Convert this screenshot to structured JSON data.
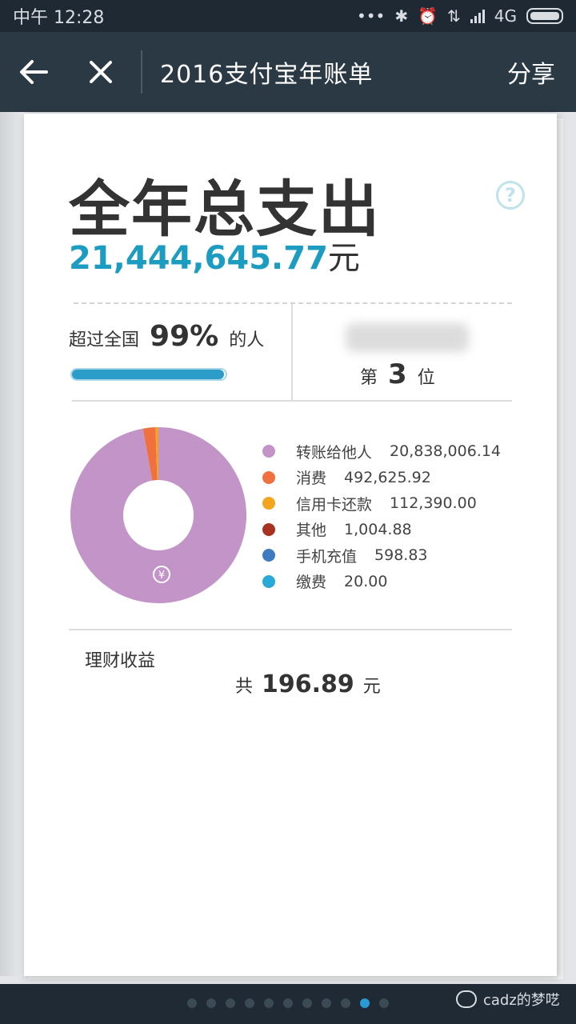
{
  "status_bar": {
    "time": "中午 12:28",
    "network": "4G"
  },
  "nav": {
    "back_icon": "←",
    "close_icon": "✕",
    "title": "2016支付宝年账单",
    "share": "分享"
  },
  "summary": {
    "heading": "全年总支出",
    "amount": "21,444,645.77",
    "unit": "元",
    "help_icon": "?",
    "surpass_prefix": "超过全国",
    "surpass_pct": "99%",
    "surpass_suffix": "的人",
    "progress_fraction": 0.99,
    "rank_prefix": "第",
    "rank": "3",
    "rank_suffix": "位"
  },
  "chart_data": {
    "type": "pie",
    "series": [
      {
        "label": "转账给他人",
        "value": 20838006.14,
        "display": "20,838,006.14",
        "color": "#c394c7"
      },
      {
        "label": "消费",
        "value": 492625.92,
        "display": "492,625.92",
        "color": "#f07040"
      },
      {
        "label": "信用卡还款",
        "value": 112390.0,
        "display": "112,390.00",
        "color": "#f2a51f"
      },
      {
        "label": "其他",
        "value": 1004.88,
        "display": "1,004.88",
        "color": "#a83222"
      },
      {
        "label": "手机充值",
        "value": 598.83,
        "display": "598.83",
        "color": "#3f7bbf"
      },
      {
        "label": "缴费",
        "value": 20.0,
        "display": "20.00",
        "color": "#2aa8d8"
      }
    ],
    "center_icon": "¥"
  },
  "finance": {
    "label": "理财收益",
    "prefix": "共",
    "amount": "196.89",
    "unit": "元"
  },
  "pager": {
    "count": 11,
    "active_index": 9
  },
  "watermark": {
    "text": "cadz的梦呓"
  }
}
